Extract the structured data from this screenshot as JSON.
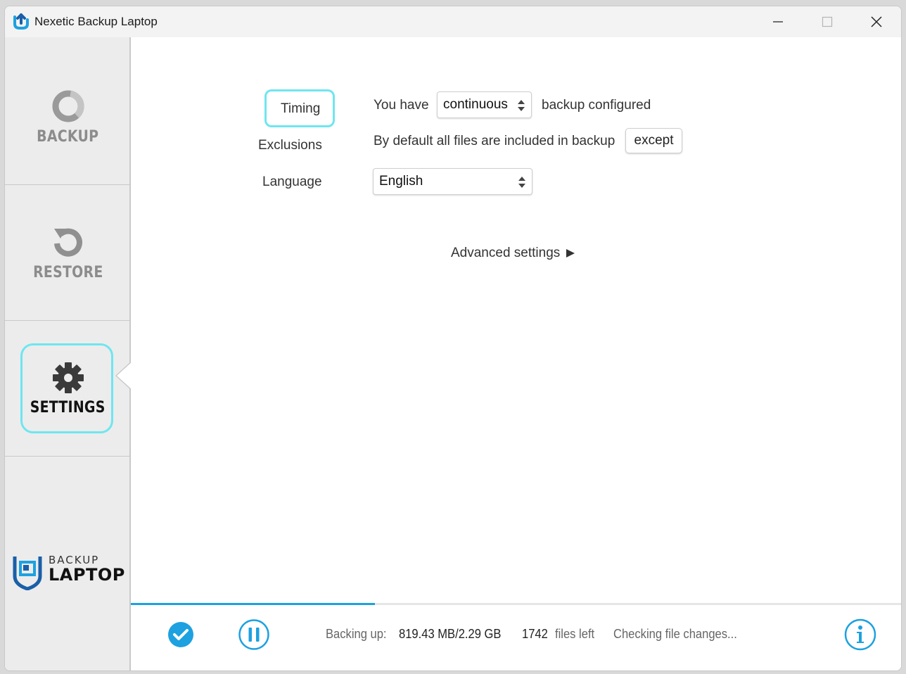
{
  "window": {
    "title": "Nexetic Backup Laptop",
    "accent": "#1da1e0",
    "highlight": "#6fe6ef"
  },
  "sidebar": {
    "items": [
      {
        "label": "BACKUP",
        "icon": "backup-ring-icon"
      },
      {
        "label": "RESTORE",
        "icon": "restore-arrow-icon"
      },
      {
        "label": "SETTINGS",
        "icon": "gear-icon",
        "active": true
      }
    ],
    "brand": {
      "line1": "BACKUP",
      "line2": "LAPTOP"
    }
  },
  "settings": {
    "timing": {
      "label": "Timing",
      "prefix": "You have",
      "value": "continuous",
      "suffix": "backup configured"
    },
    "exclusions": {
      "label": "Exclusions",
      "text": "By default all files are included in backup",
      "button": "except"
    },
    "language": {
      "label": "Language",
      "value": "English"
    },
    "advanced": "Advanced settings"
  },
  "status": {
    "backing_label": "Backing up:",
    "backing_value": "819.43 MB/2.29 GB",
    "files_count": "1742",
    "files_label": "files left",
    "message": "Checking file changes...",
    "progress": 0.316
  }
}
